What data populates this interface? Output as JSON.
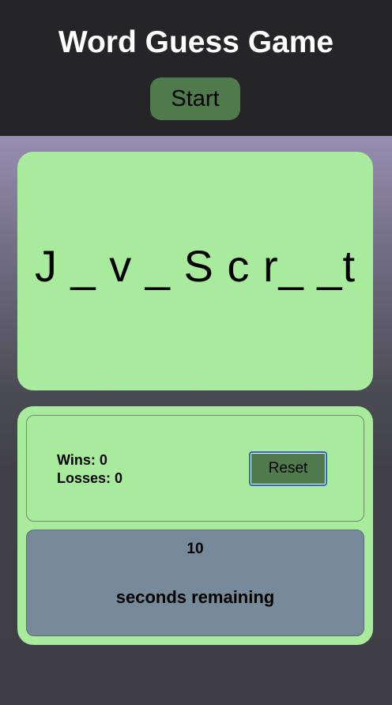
{
  "header": {
    "title": "Word Guess Game",
    "start_label": "Start"
  },
  "game": {
    "word_display": "J _ v _ S c r_ _t"
  },
  "score": {
    "wins_label": "Wins: 0",
    "losses_label": "Losses: 0",
    "reset_label": "Reset"
  },
  "timer": {
    "seconds": "10",
    "label": "seconds remaining"
  },
  "colors": {
    "header_bg": "#252528",
    "button_green": "#4f7a4b",
    "card_green": "#a8eb9d",
    "timer_panel": "#778a9a",
    "focus_ring": "#2a64c9"
  }
}
